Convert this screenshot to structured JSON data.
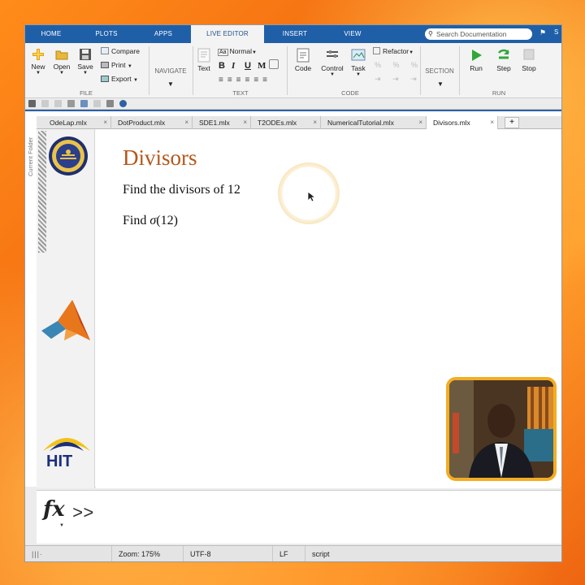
{
  "toolstrip": {
    "tabs": [
      "HOME",
      "PLOTS",
      "APPS",
      "LIVE EDITOR",
      "INSERT",
      "VIEW"
    ],
    "active_tab": "LIVE EDITOR",
    "search_placeholder": "Search Documentation",
    "account_initial": "S"
  },
  "ribbon": {
    "file": {
      "new": "New",
      "open": "Open",
      "save": "Save",
      "compare": "Compare",
      "print": "Print",
      "export": "Export",
      "group": "FILE"
    },
    "navigate": {
      "label": "NAVIGATE"
    },
    "text": {
      "text": "Text",
      "style": "Normal",
      "bold": "B",
      "italic": "I",
      "underline": "U",
      "mono": "M",
      "group": "TEXT"
    },
    "code": {
      "code": "Code",
      "control": "Control",
      "task": "Task",
      "refactor": "Refactor",
      "group": "CODE"
    },
    "section": {
      "label": "SECTION"
    },
    "run": {
      "run": "Run",
      "step": "Step",
      "stop": "Stop",
      "group": "RUN"
    }
  },
  "side_panel_label": "Current Folder",
  "file_tabs": [
    "OdeLap.mlx",
    "DotProduct.mlx",
    "SDE1.mlx",
    "T2ODEs.mlx",
    "NumericalTutorial.mlx",
    "Divisors.mlx"
  ],
  "active_file": "Divisors.mlx",
  "document": {
    "title": "Divisors",
    "line1": "Find the divisors of 12",
    "line2_prefix": "Find ",
    "line2_sigma": "σ",
    "line2_suffix": "(12)"
  },
  "logos": {
    "hit": "HIT"
  },
  "command_window": {
    "fx": "fx",
    "prompt": ">>"
  },
  "status": {
    "zoom": "Zoom: 175%",
    "encoding": "UTF-8",
    "line_ending": "LF",
    "mode": "script"
  },
  "colors": {
    "toolstrip_blue": "#1f5fa8",
    "title_color": "#b5571a",
    "cursor_ring": "#f1c04d",
    "webcam_frame": "#f3ad23",
    "background": "#f07a1a"
  }
}
